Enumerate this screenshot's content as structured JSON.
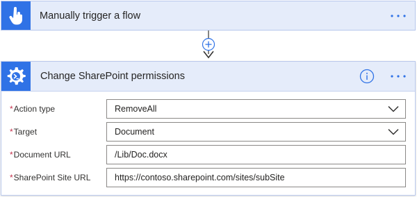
{
  "trigger": {
    "title": "Manually trigger a flow",
    "icon": "touch-hand-icon",
    "accent": "#2f72e6"
  },
  "connector": {
    "add_icon": "plus-circle-icon"
  },
  "action": {
    "title": "Change SharePoint permissions",
    "icon": "gear-powershell-icon",
    "info_icon": "info-icon",
    "more_icon": "ellipsis-icon"
  },
  "form": {
    "fields": [
      {
        "label": "Action type",
        "required_mark": "*",
        "value": "RemoveAll",
        "kind": "dropdown"
      },
      {
        "label": "Target",
        "required_mark": "*",
        "value": "Document",
        "kind": "dropdown"
      },
      {
        "label": "Document URL",
        "required_mark": "*",
        "value": "/Lib/Doc.docx",
        "kind": "text"
      },
      {
        "label": "SharePoint Site URL",
        "required_mark": "*",
        "value": "https://contoso.sharepoint.com/sites/subSite",
        "kind": "text"
      }
    ]
  },
  "colors": {
    "header_bg": "#e5ecfa",
    "icon_bg": "#2f72e6",
    "required": "#c4314b"
  }
}
